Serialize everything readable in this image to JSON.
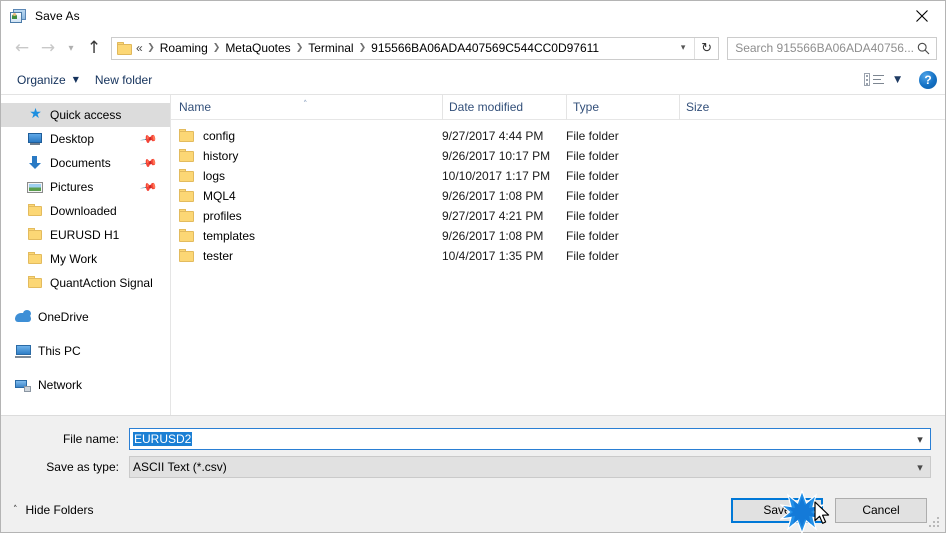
{
  "window": {
    "title": "Save As",
    "icon": "save-as-app-icon",
    "close_icon": "close-icon"
  },
  "nav": {
    "back_icon": "back-arrow-icon",
    "forward_icon": "forward-arrow-icon",
    "recent_icon": "chevron-down-icon",
    "up_icon": "up-arrow-icon",
    "folder_icon": "folder-icon",
    "breadcrumb": {
      "lead": "«",
      "items": [
        "Roaming",
        "MetaQuotes",
        "Terminal",
        "915566BA06ADA407569C544CC0D97611"
      ],
      "separator": "❯",
      "dropdown_icon": "chevron-down-icon",
      "refresh_icon": "refresh-icon"
    },
    "search": {
      "placeholder": "Search 915566BA06ADA40756...",
      "icon": "search-icon"
    }
  },
  "toolbar": {
    "organize_label": "Organize",
    "organize_caret": "▼",
    "new_folder_label": "New folder",
    "view_icon": "view-layout-icon",
    "view_caret": "▼",
    "help_label": "?",
    "help_icon": "help-icon"
  },
  "sidebar": {
    "items": [
      {
        "label": "Quick access",
        "icon": "star-icon",
        "level": "root",
        "selected": true,
        "pinned": false
      },
      {
        "label": "Desktop",
        "icon": "desktop-icon",
        "level": "1",
        "selected": false,
        "pinned": true
      },
      {
        "label": "Documents",
        "icon": "download-icon",
        "level": "1",
        "selected": false,
        "pinned": true
      },
      {
        "label": "Pictures",
        "icon": "pictures-icon",
        "level": "1",
        "selected": false,
        "pinned": true
      },
      {
        "label": "Downloaded",
        "icon": "folder-icon",
        "level": "1",
        "selected": false,
        "pinned": false
      },
      {
        "label": "EURUSD H1",
        "icon": "folder-icon",
        "level": "1",
        "selected": false,
        "pinned": false
      },
      {
        "label": "My Work",
        "icon": "folder-icon",
        "level": "1",
        "selected": false,
        "pinned": false
      },
      {
        "label": "QuantAction Signal",
        "icon": "folder-icon",
        "level": "1",
        "selected": false,
        "pinned": false
      },
      {
        "label": "OneDrive",
        "icon": "cloud-icon",
        "level": "0",
        "selected": false,
        "pinned": false
      },
      {
        "label": "This PC",
        "icon": "computer-icon",
        "level": "0",
        "selected": false,
        "pinned": false
      },
      {
        "label": "Network",
        "icon": "network-icon",
        "level": "0",
        "selected": false,
        "pinned": false
      }
    ]
  },
  "filelist": {
    "columns": [
      "Name",
      "Date modified",
      "Type",
      "Size"
    ],
    "sort_column": "Name",
    "sort_caret": "˄",
    "rows": [
      {
        "name": "config",
        "date": "9/27/2017 4:44 PM",
        "type": "File folder",
        "size": ""
      },
      {
        "name": "history",
        "date": "9/26/2017 10:17 PM",
        "type": "File folder",
        "size": ""
      },
      {
        "name": "logs",
        "date": "10/10/2017 1:17 PM",
        "type": "File folder",
        "size": ""
      },
      {
        "name": "MQL4",
        "date": "9/26/2017 1:08 PM",
        "type": "File folder",
        "size": ""
      },
      {
        "name": "profiles",
        "date": "9/27/2017 4:21 PM",
        "type": "File folder",
        "size": ""
      },
      {
        "name": "templates",
        "date": "9/26/2017 1:08 PM",
        "type": "File folder",
        "size": ""
      },
      {
        "name": "tester",
        "date": "10/4/2017 1:35 PM",
        "type": "File folder",
        "size": ""
      }
    ]
  },
  "form": {
    "filename_label": "File name:",
    "filename_value": "EURUSD2",
    "filename_selected": true,
    "filetype_label": "Save as type:",
    "filetype_value": "ASCII Text (*.csv)",
    "dropdown_icon": "chevron-down-icon"
  },
  "footer": {
    "hide_folders_label": "Hide Folders",
    "hide_folders_caret": "˄",
    "save_label": "Save",
    "cancel_label": "Cancel",
    "resize_grip_icon": "resize-grip-icon",
    "cursor_icon": "mouse-cursor-icon",
    "click_effect_icon": "click-burst-icon"
  },
  "colors": {
    "accent": "#0078d7",
    "selection": "#1b7fd4",
    "folder": "#fcd775",
    "header_text": "#33507a",
    "sidebar_selected": "#dcdcdc"
  }
}
